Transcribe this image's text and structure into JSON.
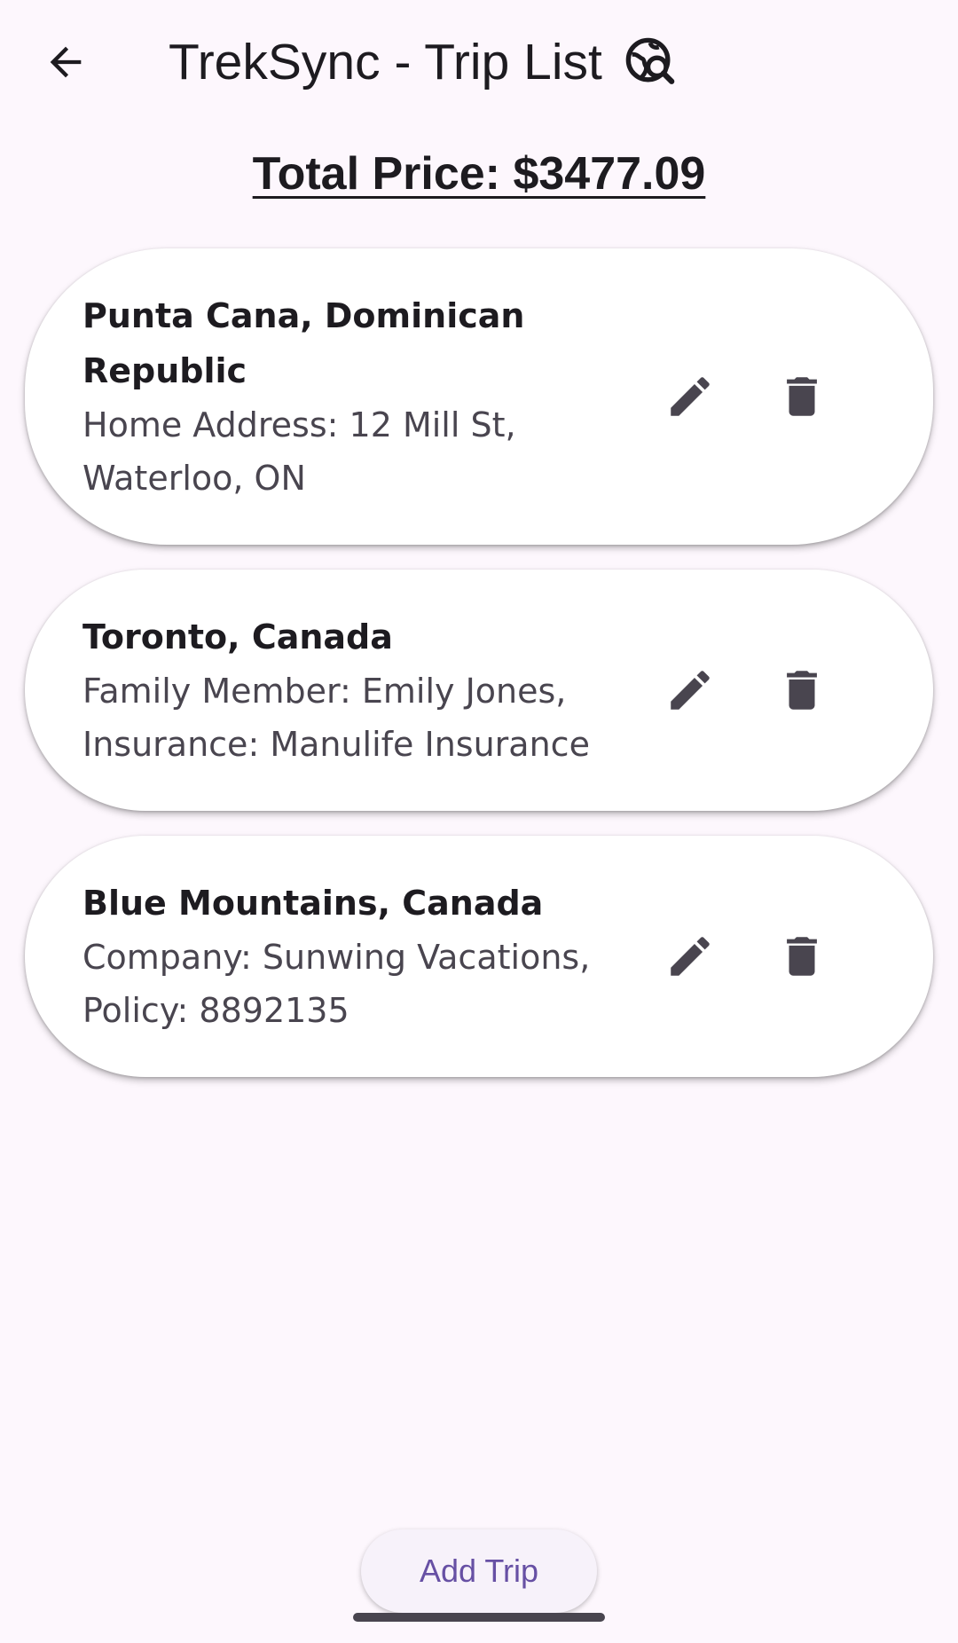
{
  "app_bar": {
    "title": "TrekSync - Trip List",
    "back_icon": "arrow-back-icon",
    "trailing_icon": "travel-explore-icon"
  },
  "summary": {
    "total_price_label": "Total Price: $3477.09"
  },
  "trips": [
    {
      "title": "Punta Cana, Dominican Republic",
      "subtitle": "Home Address: 12 Mill St, Waterloo, ON",
      "edit_icon": "edit-icon",
      "delete_icon": "delete-icon"
    },
    {
      "title": "Toronto, Canada",
      "subtitle": "Family Member: Emily Jones, Insurance: Manulife Insurance",
      "edit_icon": "edit-icon",
      "delete_icon": "delete-icon"
    },
    {
      "title": "Blue Mountains, Canada",
      "subtitle": "Company: Sunwing Vacations, Policy: 8892135",
      "edit_icon": "edit-icon",
      "delete_icon": "delete-icon"
    }
  ],
  "actions": {
    "add_trip_label": "Add Trip"
  },
  "colors": {
    "background": "#fdf7fd",
    "card": "#ffffff",
    "primary": "#6750a4",
    "icon": "#49454f",
    "text": "#1d1b20"
  }
}
